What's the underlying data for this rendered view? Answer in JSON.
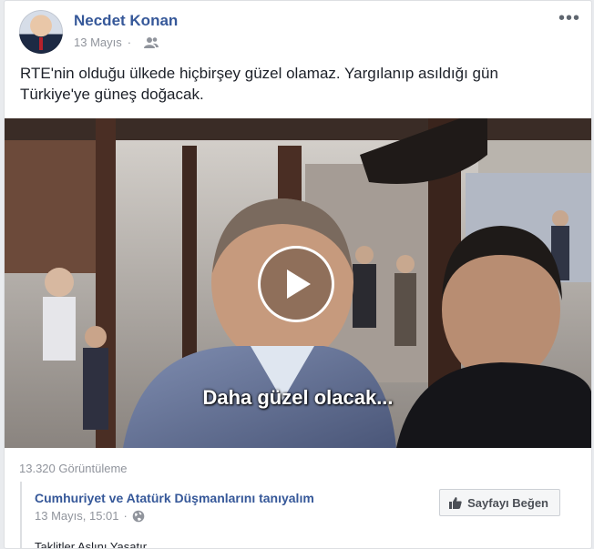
{
  "post": {
    "author": "Necdet Konan",
    "date": "13 Mayıs",
    "separator": "·",
    "audience_icon": "friends-icon",
    "text": "RTE'nin olduğu ülkede hiçbirşey güzel olamaz. Yargılanıp asıldığı gün Türkiye'ye güneş doğacak.",
    "more_label": "•••"
  },
  "video": {
    "caption": "Daha güzel olacak...",
    "play_icon": "play-icon",
    "views": "13.320 Görüntüleme"
  },
  "shared": {
    "page_name": "Cumhuriyet ve Atatürk Düşmanlarını tanıyalım",
    "date": "13 Mayıs, 15:01",
    "separator": "·",
    "globe_icon": "globe-icon",
    "like_button": "Sayfayı Beğen",
    "preview_text": "Taklitler Aslını Yaşatır"
  },
  "colors": {
    "link_blue": "#365899",
    "meta_gray": "#90949c",
    "text": "#1d2129"
  }
}
